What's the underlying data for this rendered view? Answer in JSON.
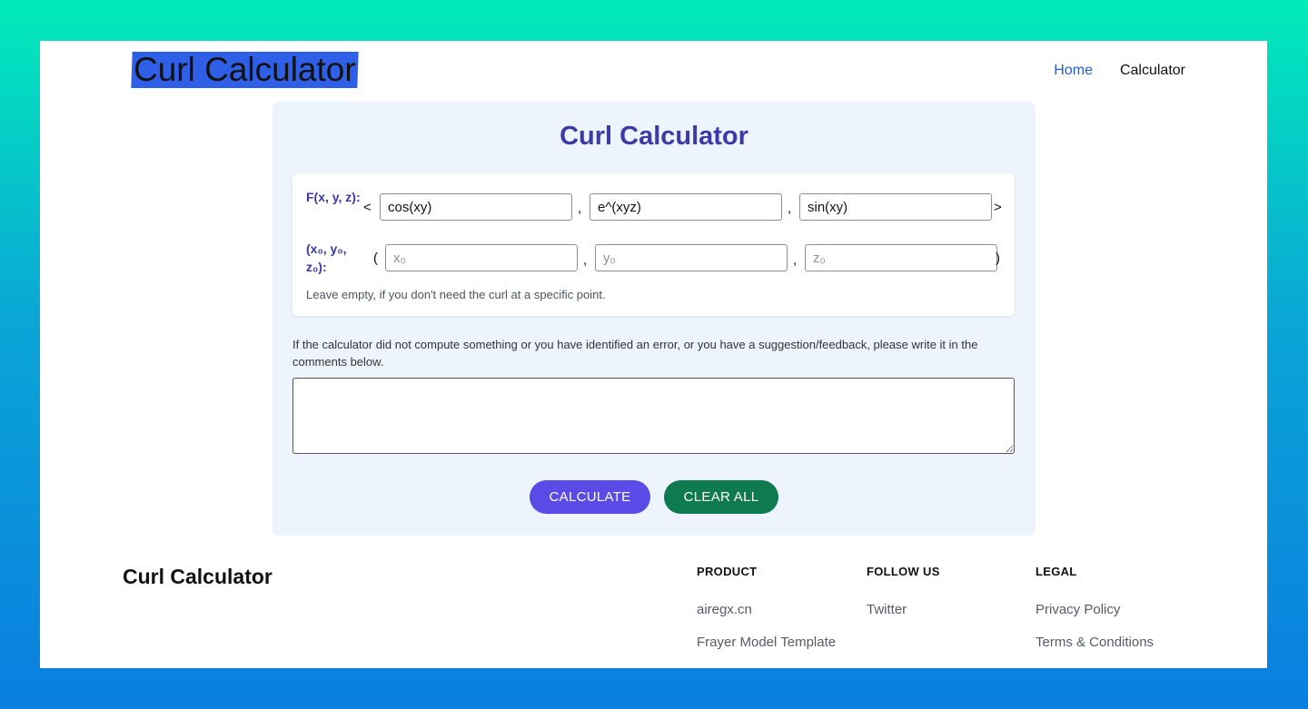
{
  "header": {
    "brand": "Curl Calculator",
    "nav": [
      {
        "label": "Home",
        "active": true
      },
      {
        "label": "Calculator",
        "active": false
      }
    ]
  },
  "calculator": {
    "title": "Curl Calculator",
    "field_label": "F(x, y, z):",
    "open_angle": "<",
    "close_angle": ">",
    "components": [
      "cos(xy)",
      "e^(xyz)",
      "sin(xy)"
    ],
    "point_label": "(x₀, y₀, z₀):",
    "open_paren": "(",
    "close_paren": ")",
    "comma": ",",
    "point_placeholders": [
      "x₀",
      "y₀",
      "z₀"
    ],
    "hint": "Leave empty, if you don't need the curl at a specific point.",
    "comment_prompt": "If the calculator did not compute something or you have identified an error, or you have a suggestion/feedback, please write it in the comments below.",
    "calculate_label": "CALCULATE",
    "clear_label": "CLEAR ALL"
  },
  "footer": {
    "brand": "Curl Calculator",
    "columns": [
      {
        "heading": "PRODUCT",
        "links": [
          "airegx.cn",
          "Frayer Model Template"
        ]
      },
      {
        "heading": "FOLLOW US",
        "links": [
          "Twitter"
        ]
      },
      {
        "heading": "LEGAL",
        "links": [
          "Privacy Policy",
          "Terms & Conditions"
        ]
      }
    ]
  },
  "colors": {
    "accent": "#3b3aa8",
    "calculate": "#5a4be7",
    "clear": "#0f7a50",
    "nav_active": "#1f5fd8"
  }
}
